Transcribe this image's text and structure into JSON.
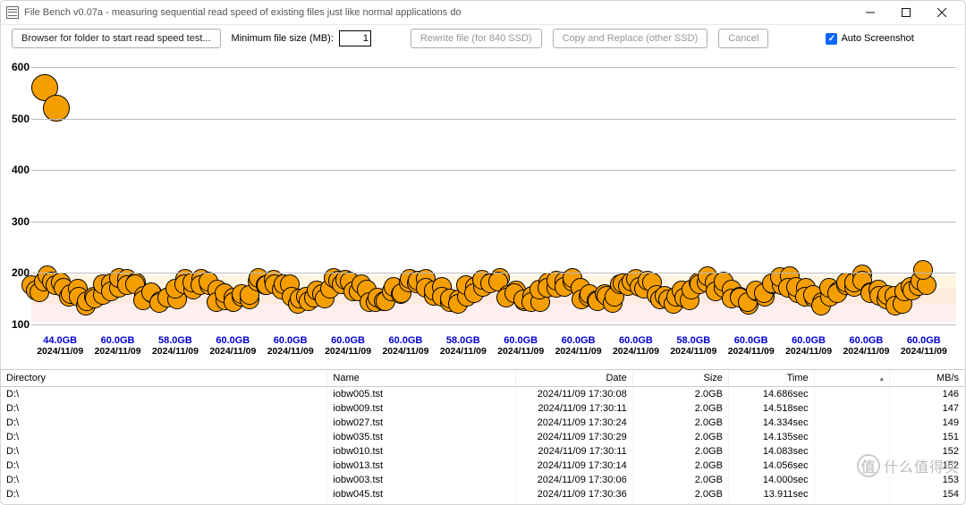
{
  "window": {
    "title": "File Bench v0.07a - measuring sequential read speed of existing files just like normal applications do"
  },
  "toolbar": {
    "browse_label": "Browser for folder to start read speed test...",
    "min_file_label": "Minimum file size (MB):",
    "min_file_value": "1",
    "rewrite_label": "Rewrite file (for 840 SSD)",
    "copy_label": "Copy and Replace (other SSD)",
    "cancel_label": "Cancel",
    "auto_screenshot_label": "Auto Screenshot"
  },
  "chart_data": {
    "type": "scatter",
    "ylabel": "",
    "xlabel": "",
    "ylim": [
      80,
      620
    ],
    "y_ticks": [
      100,
      200,
      300,
      400,
      500,
      600
    ],
    "x_categories": [
      {
        "gb": "44.0GB",
        "date": "2024/11/09"
      },
      {
        "gb": "60.0GB",
        "date": "2024/11/09"
      },
      {
        "gb": "58.0GB",
        "date": "2024/11/09"
      },
      {
        "gb": "60.0GB",
        "date": "2024/11/09"
      },
      {
        "gb": "60.0GB",
        "date": "2024/11/09"
      },
      {
        "gb": "60.0GB",
        "date": "2024/11/09"
      },
      {
        "gb": "60.0GB",
        "date": "2024/11/09"
      },
      {
        "gb": "58.0GB",
        "date": "2024/11/09"
      },
      {
        "gb": "60.0GB",
        "date": "2024/11/09"
      },
      {
        "gb": "60.0GB",
        "date": "2024/11/09"
      },
      {
        "gb": "60.0GB",
        "date": "2024/11/09"
      },
      {
        "gb": "58.0GB",
        "date": "2024/11/09"
      },
      {
        "gb": "60.0GB",
        "date": "2024/11/09"
      },
      {
        "gb": "60.0GB",
        "date": "2024/11/09"
      },
      {
        "gb": "60.0GB",
        "date": "2024/11/09"
      },
      {
        "gb": "60.0GB",
        "date": "2024/11/09"
      }
    ],
    "outliers": [
      {
        "x": 0.015,
        "y": 560
      },
      {
        "x": 0.028,
        "y": 520
      }
    ],
    "band_y": [
      140,
      195
    ],
    "main_cluster_y_range": [
      135,
      200
    ]
  },
  "table": {
    "columns": [
      "Directory",
      "Name",
      "Date",
      "Size",
      "Time",
      "",
      "MB/s"
    ],
    "col_widths": [
      "304px",
      "170px",
      "100px",
      "80px",
      "70px",
      "60px",
      "60px"
    ],
    "sort_col_index": 5,
    "rows": [
      {
        "dir": "D:\\",
        "name": "iobw005.tst",
        "date": "2024/11/09 17:30:08",
        "size": "2.0GB",
        "time": "14.686sec",
        "mbs": "146"
      },
      {
        "dir": "D:\\",
        "name": "iobw009.tst",
        "date": "2024/11/09 17:30:11",
        "size": "2.0GB",
        "time": "14.518sec",
        "mbs": "147"
      },
      {
        "dir": "D:\\",
        "name": "iobw027.tst",
        "date": "2024/11/09 17:30:24",
        "size": "2.0GB",
        "time": "14.334sec",
        "mbs": "149"
      },
      {
        "dir": "D:\\",
        "name": "iobw035.tst",
        "date": "2024/11/09 17:30:29",
        "size": "2.0GB",
        "time": "14.135sec",
        "mbs": "151"
      },
      {
        "dir": "D:\\",
        "name": "iobw010.tst",
        "date": "2024/11/09 17:30:11",
        "size": "2.0GB",
        "time": "14.083sec",
        "mbs": "152"
      },
      {
        "dir": "D:\\",
        "name": "iobw013.tst",
        "date": "2024/11/09 17:30:14",
        "size": "2.0GB",
        "time": "14.056sec",
        "mbs": "152"
      },
      {
        "dir": "D:\\",
        "name": "iobw003.tst",
        "date": "2024/11/09 17:30:06",
        "size": "2.0GB",
        "time": "14.000sec",
        "mbs": "153"
      },
      {
        "dir": "D:\\",
        "name": "iobw045.tst",
        "date": "2024/11/09 17:30:36",
        "size": "2.0GB",
        "time": "13.911sec",
        "mbs": "154"
      }
    ]
  },
  "watermark": {
    "text": "什么值得买",
    "logo": "值"
  }
}
